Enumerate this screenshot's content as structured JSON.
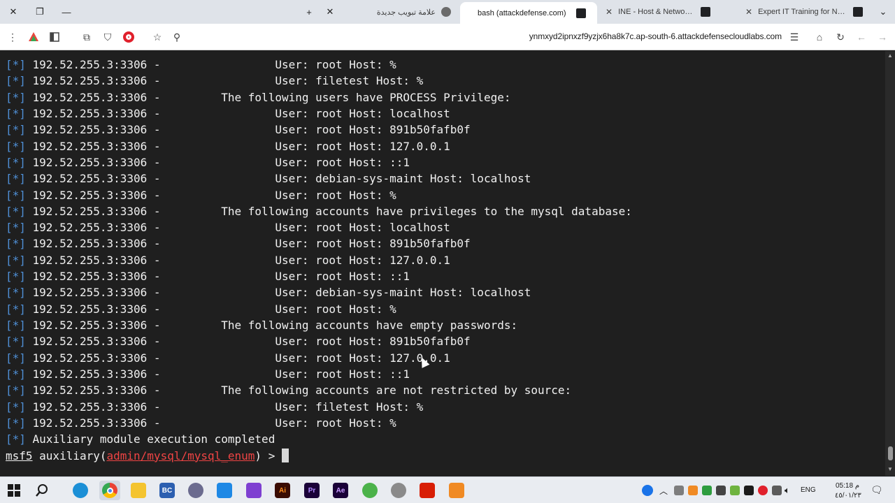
{
  "tabs": [
    {
      "title": "علامة تبويب جديدة",
      "favicon_color": "#5f6368",
      "active": false
    },
    {
      "title": "bash (attackdefense.com)",
      "favicon_color": "#202124",
      "active": true
    },
    {
      "title": "INE - Host & Network Penetrat",
      "favicon_color": "#202124",
      "active": false
    },
    {
      "title": "Expert IT Training for Networki",
      "favicon_color": "#202124",
      "active": false
    }
  ],
  "address_bar": {
    "url": "ynmxyd2ipnxzf9yzjx6ha8k7c.ap-south-6.attackdefensecloudlabs.com"
  },
  "terminal": {
    "lines": [
      {
        "tag": "[*]",
        "text": " 192.52.255.3:3306 -                 User: root Host: %"
      },
      {
        "tag": "[*]",
        "text": " 192.52.255.3:3306 -                 User: filetest Host: %"
      },
      {
        "tag": "[*]",
        "text": " 192.52.255.3:3306 -         The following users have PROCESS Privilege:"
      },
      {
        "tag": "[*]",
        "text": " 192.52.255.3:3306 -                 User: root Host: localhost"
      },
      {
        "tag": "[*]",
        "text": " 192.52.255.3:3306 -                 User: root Host: 891b50fafb0f"
      },
      {
        "tag": "[*]",
        "text": " 192.52.255.3:3306 -                 User: root Host: 127.0.0.1"
      },
      {
        "tag": "[*]",
        "text": " 192.52.255.3:3306 -                 User: root Host: ::1"
      },
      {
        "tag": "[*]",
        "text": " 192.52.255.3:3306 -                 User: debian-sys-maint Host: localhost"
      },
      {
        "tag": "[*]",
        "text": " 192.52.255.3:3306 -                 User: root Host: %"
      },
      {
        "tag": "[*]",
        "text": " 192.52.255.3:3306 -         The following accounts have privileges to the mysql database:"
      },
      {
        "tag": "[*]",
        "text": " 192.52.255.3:3306 -                 User: root Host: localhost"
      },
      {
        "tag": "[*]",
        "text": " 192.52.255.3:3306 -                 User: root Host: 891b50fafb0f"
      },
      {
        "tag": "[*]",
        "text": " 192.52.255.3:3306 -                 User: root Host: 127.0.0.1"
      },
      {
        "tag": "[*]",
        "text": " 192.52.255.3:3306 -                 User: root Host: ::1"
      },
      {
        "tag": "[*]",
        "text": " 192.52.255.3:3306 -                 User: debian-sys-maint Host: localhost"
      },
      {
        "tag": "[*]",
        "text": " 192.52.255.3:3306 -                 User: root Host: %"
      },
      {
        "tag": "[*]",
        "text": " 192.52.255.3:3306 -         The following accounts have empty passwords:"
      },
      {
        "tag": "[*]",
        "text": " 192.52.255.3:3306 -                 User: root Host: 891b50fafb0f"
      },
      {
        "tag": "[*]",
        "text": " 192.52.255.3:3306 -                 User: root Host: 127.0.0.1"
      },
      {
        "tag": "[*]",
        "text": " 192.52.255.3:3306 -                 User: root Host: ::1"
      },
      {
        "tag": "[*]",
        "text": " 192.52.255.3:3306 -         The following accounts are not restricted by source:"
      },
      {
        "tag": "[*]",
        "text": " 192.52.255.3:3306 -                 User: filetest Host: %"
      },
      {
        "tag": "[*]",
        "text": " 192.52.255.3:3306 -                 User: root Host: %"
      },
      {
        "tag": "[*]",
        "text": " Auxiliary module execution completed"
      }
    ],
    "prompt": {
      "prefix": "msf5",
      "module_word": " auxiliary(",
      "module": "admin/mysql/mysql_enum",
      "suffix": ") > "
    },
    "colors": {
      "tag": "#4f8fd6",
      "module": "#ef4444",
      "text": "#f0f0f0",
      "background": "#1f1f1f"
    }
  },
  "taskbar": {
    "apps": [
      {
        "name": "start-icon"
      },
      {
        "name": "search-icon"
      },
      {
        "name": "edge-icon"
      },
      {
        "name": "chrome-icon"
      },
      {
        "name": "file-explorer-icon"
      },
      {
        "name": "bc-app-icon",
        "label": "BC"
      },
      {
        "name": "terminal-app-icon"
      },
      {
        "name": "vscode-icon"
      },
      {
        "name": "visual-studio-icon"
      },
      {
        "name": "illustrator-icon",
        "label": "Ai"
      },
      {
        "name": "premiere-icon",
        "label": "Pr"
      },
      {
        "name": "after-effects-icon",
        "label": "Ae"
      },
      {
        "name": "utorrent-icon"
      },
      {
        "name": "network-app-icon"
      },
      {
        "name": "acrobat-icon"
      },
      {
        "name": "orange-app-icon"
      }
    ],
    "language": "ENG",
    "time": "05:18",
    "am_pm": "م",
    "date": "٤٥/٠١/٢٣"
  }
}
